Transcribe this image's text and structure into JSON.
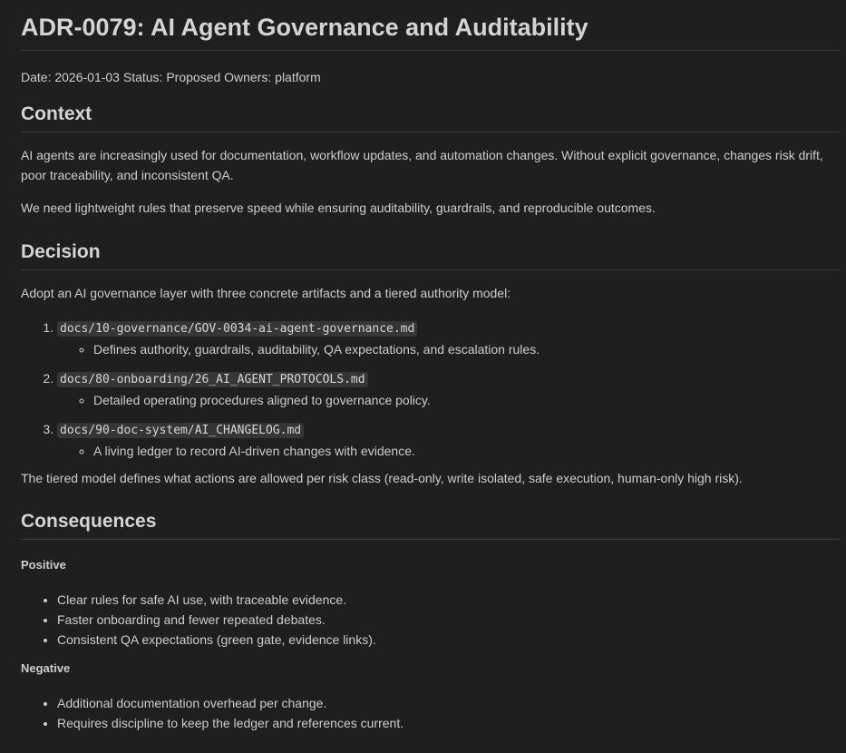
{
  "title": "ADR-0079: AI Agent Governance and Auditability",
  "meta": "Date: 2026-01-03 Status: Proposed Owners: platform",
  "context": {
    "heading": "Context",
    "p1": "AI agents are increasingly used for documentation, workflow updates, and automation changes. Without explicit governance, changes risk drift, poor traceability, and inconsistent QA.",
    "p2": "We need lightweight rules that preserve speed while ensuring auditability, guardrails, and reproducible outcomes."
  },
  "decision": {
    "heading": "Decision",
    "intro": "Adopt an AI governance layer with three concrete artifacts and a tiered authority model:",
    "items": [
      {
        "path": "docs/10-governance/GOV-0034-ai-agent-governance.md",
        "desc": "Defines authority, guardrails, auditability, QA expectations, and escalation rules."
      },
      {
        "path": "docs/80-onboarding/26_AI_AGENT_PROTOCOLS.md",
        "desc": "Detailed operating procedures aligned to governance policy."
      },
      {
        "path": "docs/90-doc-system/AI_CHANGELOG.md",
        "desc": "A living ledger to record AI-driven changes with evidence."
      }
    ],
    "tiered": "The tiered model defines what actions are allowed per risk class (read-only, write isolated, safe execution, human-only high risk)."
  },
  "consequences": {
    "heading": "Consequences",
    "positive_label": "Positive",
    "positive": [
      "Clear rules for safe AI use, with traceable evidence.",
      "Faster onboarding and fewer repeated debates.",
      "Consistent QA expectations (green gate, evidence links)."
    ],
    "negative_label": "Negative",
    "negative": [
      "Additional documentation overhead per change.",
      "Requires discipline to keep the ledger and references current."
    ]
  }
}
